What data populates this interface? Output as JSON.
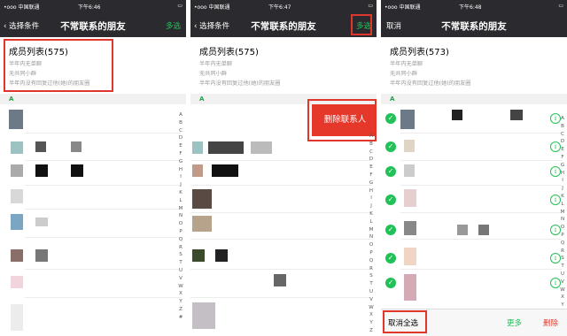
{
  "colors": {
    "nav_bg": "#2b2b2f",
    "accent_green": "#21c157",
    "delete_red": "#e5382b",
    "highlight_red": "#e0362b"
  },
  "status": {
    "carrier": "•ooo 中国联通 ",
    "p1_time": "下午6:46",
    "p2_time": "下午6:47",
    "p3_time": "下午6:48"
  },
  "screen1": {
    "back_label": "选择条件",
    "title": "不常联系的朋友",
    "right_label": "多选",
    "list_title": "成员列表(575)",
    "sub1": "半年内无单聊",
    "sub2": "无共同小群",
    "sub3": "半年内没有回复过他(她)的朋友圈",
    "section": "A"
  },
  "screen2": {
    "back_label": "选择条件",
    "title": "不常联系的朋友",
    "right_label": "多选",
    "list_title": "成员列表(575)",
    "sub1": "半年内无单聊",
    "sub2": "无共同小群",
    "sub3": "半年内没有回复过他(她)的朋友圈",
    "section": "A",
    "delete_label": "删除联系人"
  },
  "screen3": {
    "left_label": "取消",
    "title": "不常联系的朋友",
    "list_title": "成员列表(573)",
    "sub1": "半年内无单聊",
    "sub2": "无共同小群",
    "sub3": "半年内没有回复过他(她)的朋友圈",
    "section": "A",
    "toolbar": {
      "deselect_all": "取消全选",
      "more": "更多",
      "delete": "删除"
    }
  },
  "index_letters": [
    "A",
    "B",
    "C",
    "D",
    "E",
    "F",
    "G",
    "H",
    "I",
    "J",
    "K",
    "L",
    "M",
    "N",
    "O",
    "P",
    "Q",
    "R",
    "S",
    "T",
    "U",
    "V",
    "W",
    "X",
    "Y",
    "Z",
    "#"
  ]
}
